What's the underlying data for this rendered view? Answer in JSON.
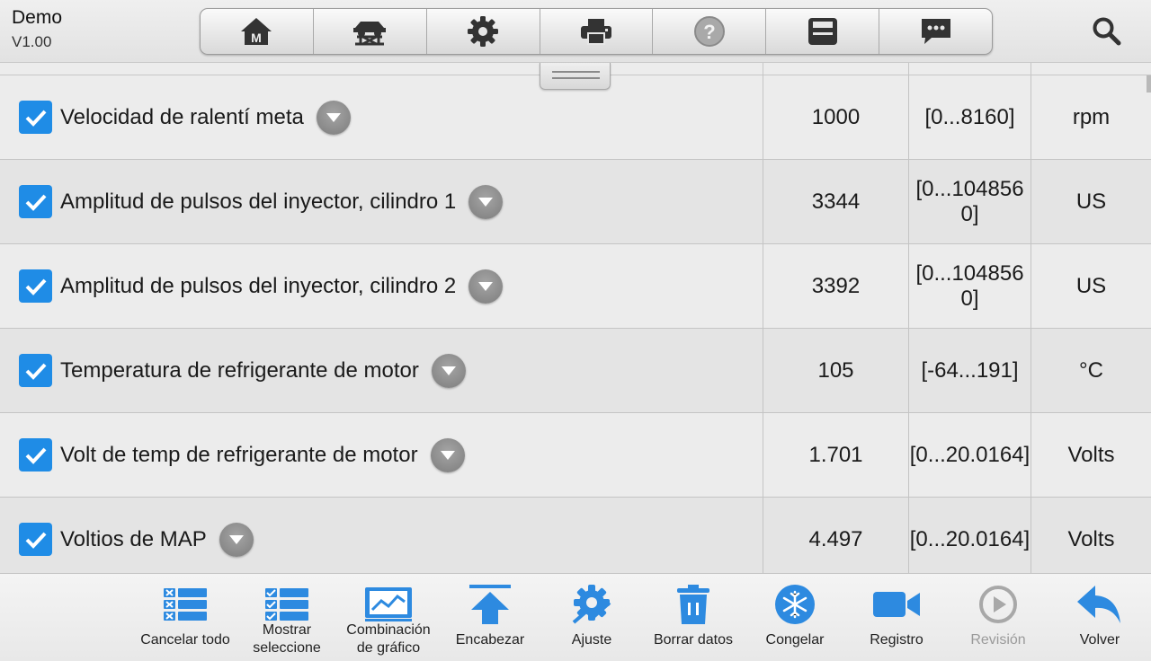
{
  "app": {
    "name": "Demo",
    "version": "V1.00"
  },
  "toolbar": {
    "buttons": [
      {
        "icon": "home-icon",
        "letter": "M"
      },
      {
        "icon": "vehicle-lift-icon"
      },
      {
        "icon": "gear-icon"
      },
      {
        "icon": "printer-icon"
      },
      {
        "icon": "help-icon",
        "glyph": "?"
      },
      {
        "icon": "save-icon"
      },
      {
        "icon": "chat-icon"
      }
    ],
    "search_icon": "search-icon"
  },
  "rows": [
    {
      "label": "Velocidad de ralentí meta",
      "value": "1000",
      "range": "[0...8160]",
      "unit": "rpm",
      "checked": true
    },
    {
      "label": "Amplitud de pulsos del inyector, cilindro 1",
      "value": "3344",
      "range": "[0...1048560]",
      "unit": "US",
      "checked": true
    },
    {
      "label": "Amplitud de pulsos del inyector, cilindro 2",
      "value": "3392",
      "range": "[0...1048560]",
      "unit": "US",
      "checked": true
    },
    {
      "label": "Temperatura de refrigerante de motor",
      "value": "105",
      "range": "[-64...191]",
      "unit": "°C",
      "checked": true
    },
    {
      "label": "Volt de temp de refrigerante de motor",
      "value": "1.701",
      "range": "[0...20.0164]",
      "unit": "Volts",
      "checked": true
    },
    {
      "label": "Voltios de MAP",
      "value": "4.497",
      "range": "[0...20.0164]",
      "unit": "Volts",
      "checked": true
    }
  ],
  "bottom_bar": {
    "cancel_all": "Cancelar todo",
    "show_selection_1": "Mostrar",
    "show_selection_2": "seleccione",
    "graph_merge_1": "Combinación",
    "graph_merge_2": "de gráfico",
    "to_top": "Encabezar",
    "settings": "Ajuste",
    "clear_data": "Borrar datos",
    "freeze": "Congelar",
    "record": "Registro",
    "review": "Revisión",
    "back": "Volver"
  },
  "colors": {
    "accent": "#1f8ce6",
    "disabled": "#9a9a9a"
  }
}
